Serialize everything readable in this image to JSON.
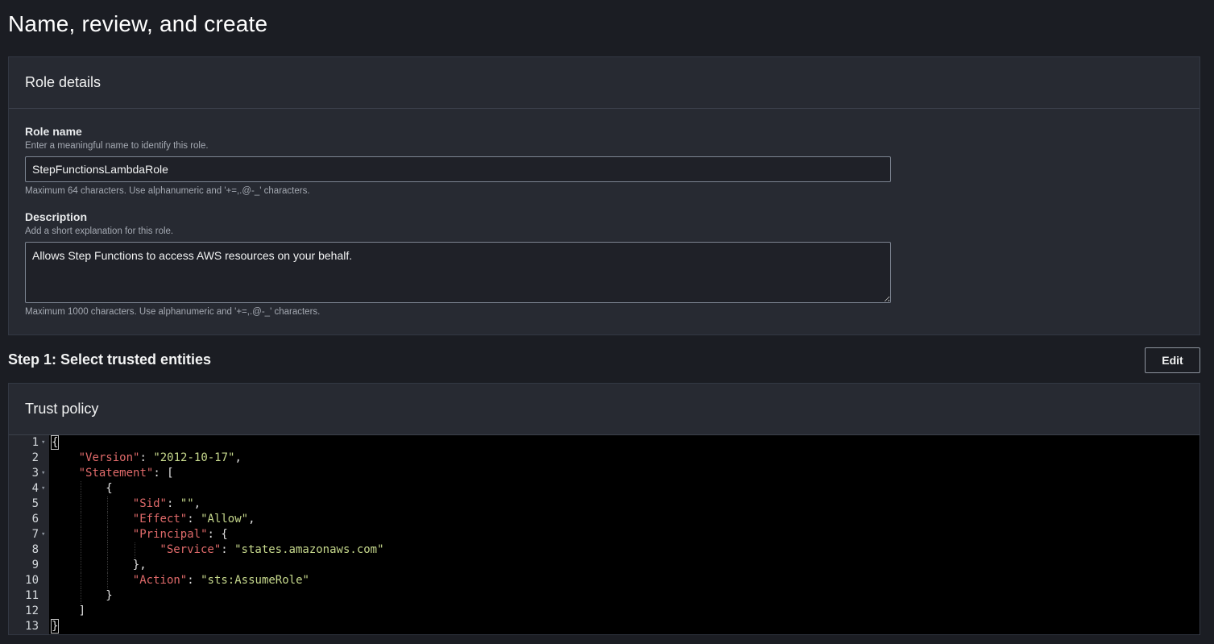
{
  "page": {
    "title": "Name, review, and create"
  },
  "role_details": {
    "header": "Role details",
    "role_name": {
      "label": "Role name",
      "help": "Enter a meaningful name to identify this role.",
      "value": "StepFunctionsLambdaRole",
      "constraint": "Maximum 64 characters. Use alphanumeric and '+=,.@-_' characters."
    },
    "description": {
      "label": "Description",
      "help": "Add a short explanation for this role.",
      "value": "Allows Step Functions to access AWS resources on your behalf.",
      "constraint": "Maximum 1000 characters. Use alphanumeric and '+=,.@-_' characters."
    }
  },
  "step1": {
    "title": "Step 1: Select trusted entities",
    "edit_label": "Edit"
  },
  "trust_policy": {
    "header": "Trust policy",
    "lines": [
      {
        "n": "1",
        "fold": true,
        "indent": 0,
        "tokens": [
          {
            "t": "pun",
            "v": "{"
          }
        ]
      },
      {
        "n": "2",
        "fold": false,
        "indent": 1,
        "tokens": [
          {
            "t": "key",
            "v": "\"Version\""
          },
          {
            "t": "pun",
            "v": ": "
          },
          {
            "t": "str",
            "v": "\"2012-10-17\""
          },
          {
            "t": "pun",
            "v": ","
          }
        ]
      },
      {
        "n": "3",
        "fold": true,
        "indent": 1,
        "tokens": [
          {
            "t": "key",
            "v": "\"Statement\""
          },
          {
            "t": "pun",
            "v": ": ["
          }
        ]
      },
      {
        "n": "4",
        "fold": true,
        "indent": 2,
        "tokens": [
          {
            "t": "pun",
            "v": "{"
          }
        ]
      },
      {
        "n": "5",
        "fold": false,
        "indent": 3,
        "tokens": [
          {
            "t": "key",
            "v": "\"Sid\""
          },
          {
            "t": "pun",
            "v": ": "
          },
          {
            "t": "str",
            "v": "\"\""
          },
          {
            "t": "pun",
            "v": ","
          }
        ]
      },
      {
        "n": "6",
        "fold": false,
        "indent": 3,
        "tokens": [
          {
            "t": "key",
            "v": "\"Effect\""
          },
          {
            "t": "pun",
            "v": ": "
          },
          {
            "t": "str",
            "v": "\"Allow\""
          },
          {
            "t": "pun",
            "v": ","
          }
        ]
      },
      {
        "n": "7",
        "fold": true,
        "indent": 3,
        "tokens": [
          {
            "t": "key",
            "v": "\"Principal\""
          },
          {
            "t": "pun",
            "v": ": {"
          }
        ]
      },
      {
        "n": "8",
        "fold": false,
        "indent": 4,
        "tokens": [
          {
            "t": "key",
            "v": "\"Service\""
          },
          {
            "t": "pun",
            "v": ": "
          },
          {
            "t": "str",
            "v": "\"states.amazonaws.com\""
          }
        ]
      },
      {
        "n": "9",
        "fold": false,
        "indent": 3,
        "tokens": [
          {
            "t": "pun",
            "v": "},"
          }
        ]
      },
      {
        "n": "10",
        "fold": false,
        "indent": 3,
        "tokens": [
          {
            "t": "key",
            "v": "\"Action\""
          },
          {
            "t": "pun",
            "v": ": "
          },
          {
            "t": "str",
            "v": "\"sts:AssumeRole\""
          }
        ]
      },
      {
        "n": "11",
        "fold": false,
        "indent": 2,
        "tokens": [
          {
            "t": "pun",
            "v": "}"
          }
        ]
      },
      {
        "n": "12",
        "fold": false,
        "indent": 1,
        "tokens": [
          {
            "t": "pun",
            "v": "]"
          }
        ]
      },
      {
        "n": "13",
        "fold": false,
        "indent": 0,
        "tokens": [
          {
            "t": "pun",
            "v": "}"
          }
        ]
      }
    ]
  },
  "colors": {
    "json_key": "#e06a6a",
    "json_string": "#c6d88c",
    "background": "#1b1d23",
    "panel": "#272a32"
  }
}
